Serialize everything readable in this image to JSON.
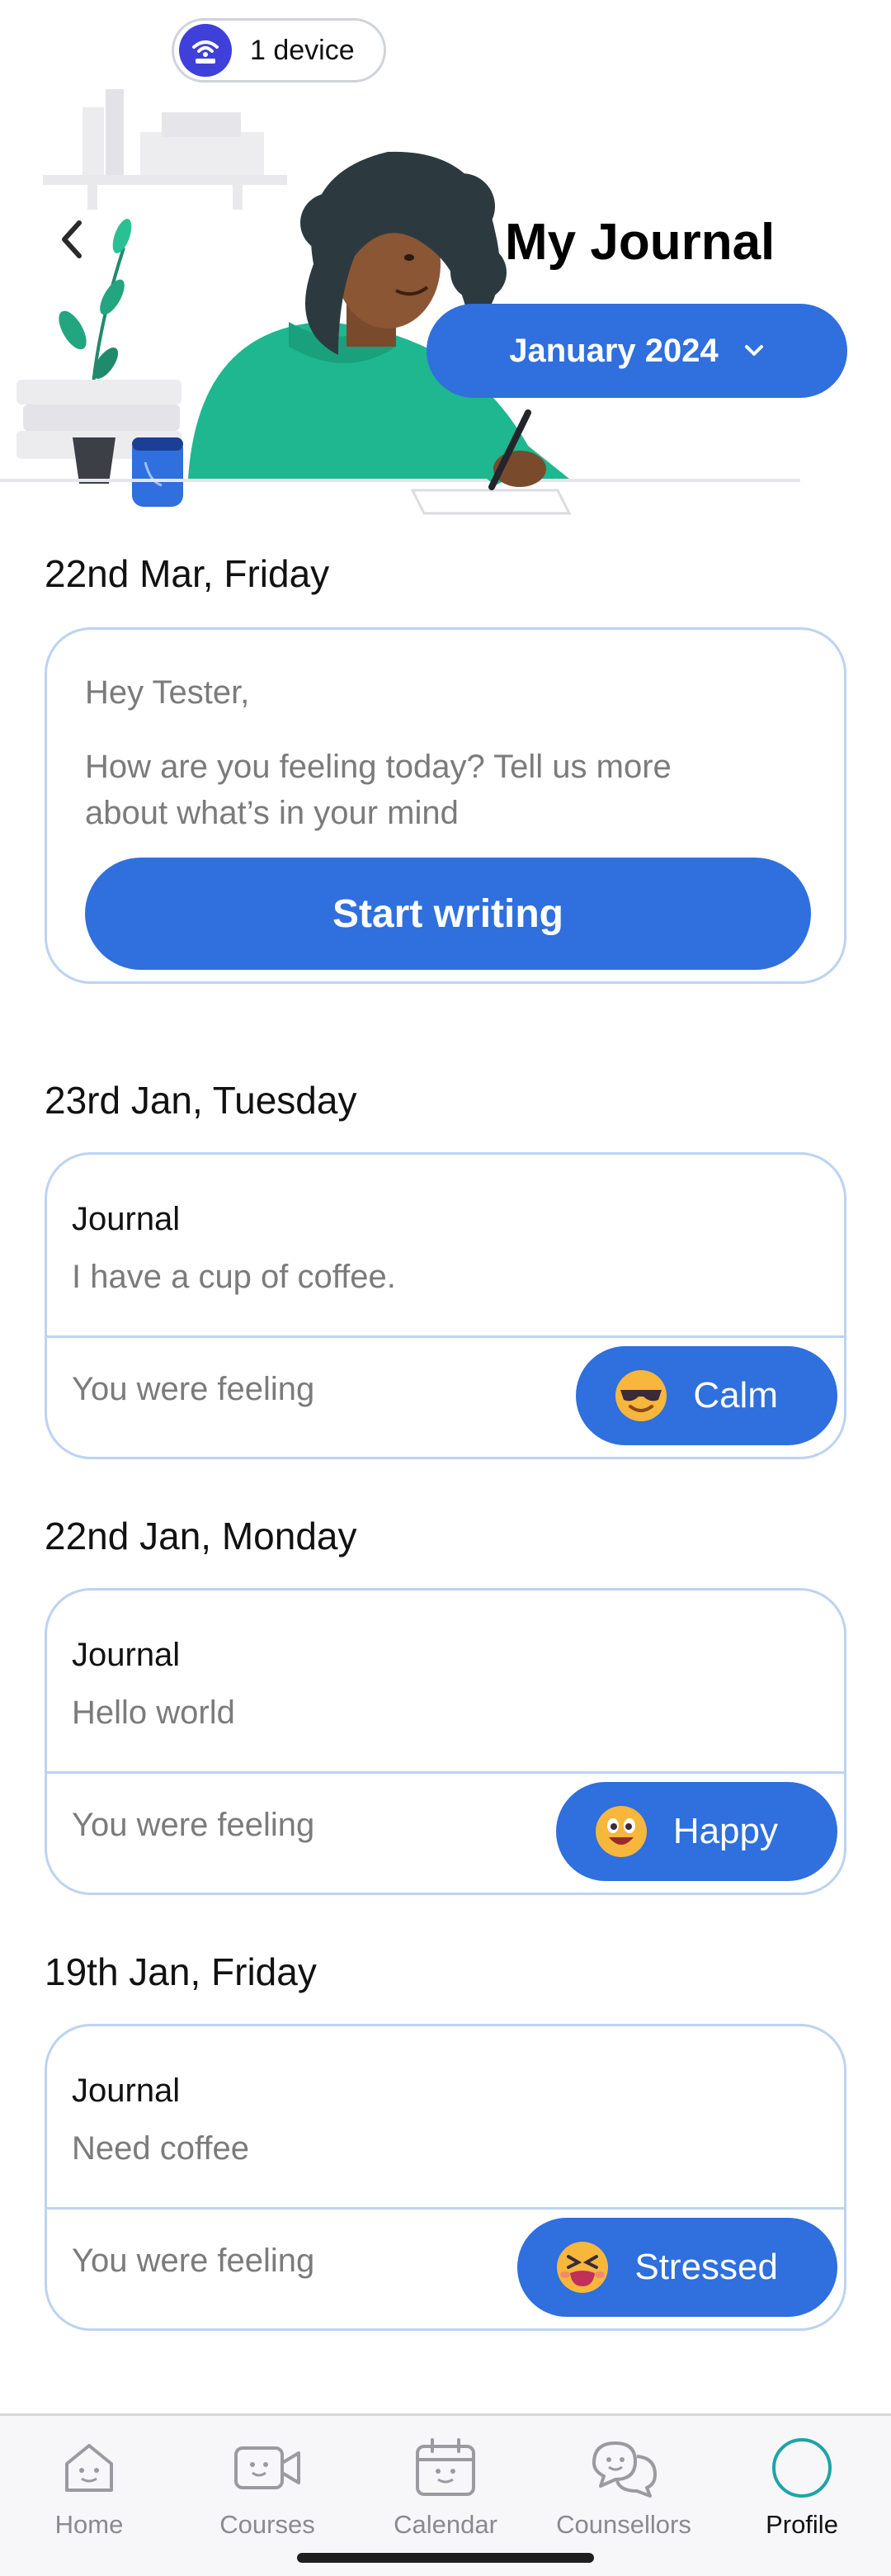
{
  "status": {
    "device_label": "1 device"
  },
  "header": {
    "title": "My Journal",
    "month": "January 2024"
  },
  "today": {
    "date": "22nd Mar, Friday",
    "greeting": "Hey Tester,",
    "prompt": "How are you feeling today? Tell us more about what’s in your mind",
    "button": "Start writing"
  },
  "entries": [
    {
      "date": "23rd Jan, Tuesday",
      "label": "Journal",
      "text": "I have a cup of coffee.",
      "feeling_label": "You were feeling",
      "mood": "Calm",
      "mood_icon": "cool-face-icon"
    },
    {
      "date": "22nd Jan, Monday",
      "label": "Journal",
      "text": "Hello world",
      "feeling_label": "You were feeling",
      "mood": "Happy",
      "mood_icon": "happy-face-icon"
    },
    {
      "date": "19th Jan, Friday",
      "label": "Journal",
      "text": "Need coffee",
      "feeling_label": "You were feeling",
      "mood": "Stressed",
      "mood_icon": "stressed-face-icon"
    }
  ],
  "nav": [
    {
      "label": "Home",
      "icon": "home-icon"
    },
    {
      "label": "Courses",
      "icon": "video-icon"
    },
    {
      "label": "Calendar",
      "icon": "calendar-icon"
    },
    {
      "label": "Counsellors",
      "icon": "chat-icon"
    },
    {
      "label": "Profile",
      "icon": "profile-icon",
      "active": true
    }
  ],
  "colors": {
    "accent": "#2f6fde",
    "card_border": "#bcd3f2",
    "device_icon_bg": "#3f40d9"
  }
}
